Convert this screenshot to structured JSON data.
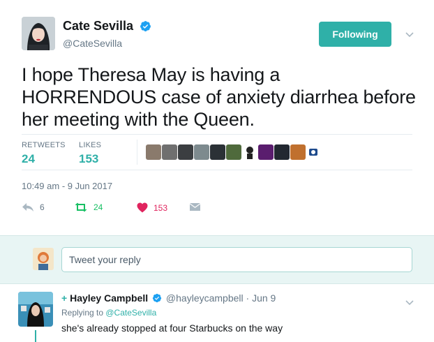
{
  "tweet": {
    "display_name": "Cate Sevilla",
    "handle": "@CateSevilla",
    "follow_label": "Following",
    "text": "I hope Theresa May is having a HORRENDOUS case of anxiety diarrhea before her meeting with the Queen.",
    "stats": {
      "retweets_label": "RETWEETS",
      "retweets_value": "24",
      "likes_label": "LIKES",
      "likes_value": "153"
    },
    "timestamp": "10:49 am - 9 Jun 2017",
    "actions": {
      "reply_count": "6",
      "retweet_count": "24",
      "like_count": "153"
    }
  },
  "reply_box": {
    "placeholder": "Tweet your reply"
  },
  "reply": {
    "plus": "+",
    "name": "Hayley Campbell",
    "handle_date": "@hayleycampbell · Jun 9",
    "replying_prefix": "Replying to ",
    "replying_to": "@CateSevilla",
    "text": "she's already stopped at four Starbucks on the way"
  },
  "colors": {
    "accent": "#2fb0a8",
    "retweet_green": "#17bf63",
    "like_red": "#e0245e",
    "muted": "#657786",
    "verified_blue": "#1da1f2"
  }
}
